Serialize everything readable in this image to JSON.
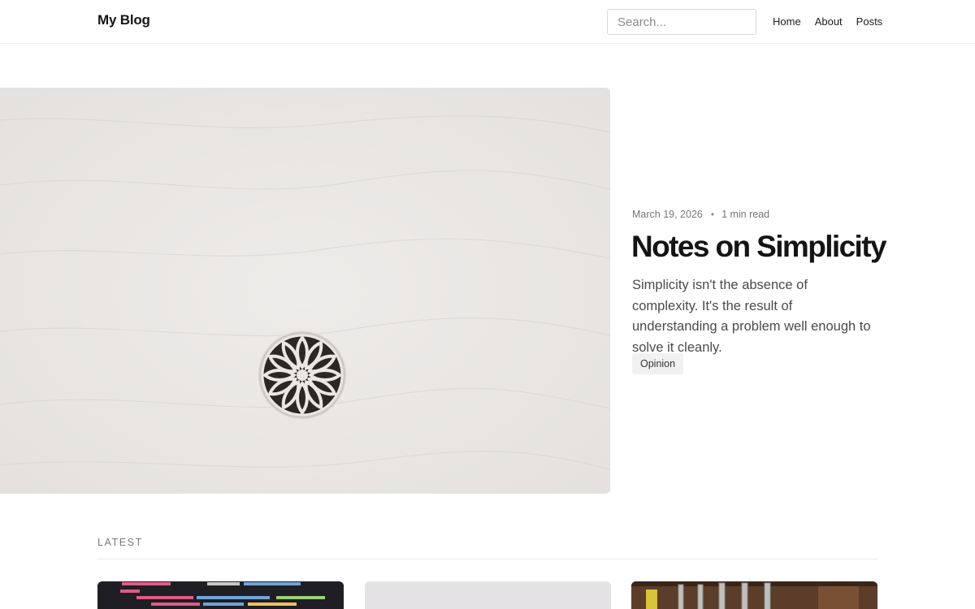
{
  "header": {
    "brand": "My Blog",
    "search_placeholder": "Search...",
    "nav": [
      "Home",
      "About",
      "Posts"
    ]
  },
  "hero": {
    "image_icon": "rosette-drain-image",
    "date": "March 19, 2026",
    "separator": "•",
    "read_time": "1 min read",
    "title": "Notes on Simplicity",
    "excerpt": "Simplicity isn't the absence of complexity. It's the result of understanding a problem well enough to solve it cleanly.",
    "tag": "Opinion"
  },
  "latest": {
    "label": "LATEST",
    "cards": [
      {
        "image": "code-screenshot-thumbnail"
      },
      {
        "image": "light-gray-thumbnail"
      },
      {
        "image": "tools-on-wood-thumbnail"
      }
    ]
  },
  "colors": {
    "text": "#141414",
    "muted": "#777777",
    "border": "#ececec",
    "tag_bg": "#f1f1f1"
  }
}
